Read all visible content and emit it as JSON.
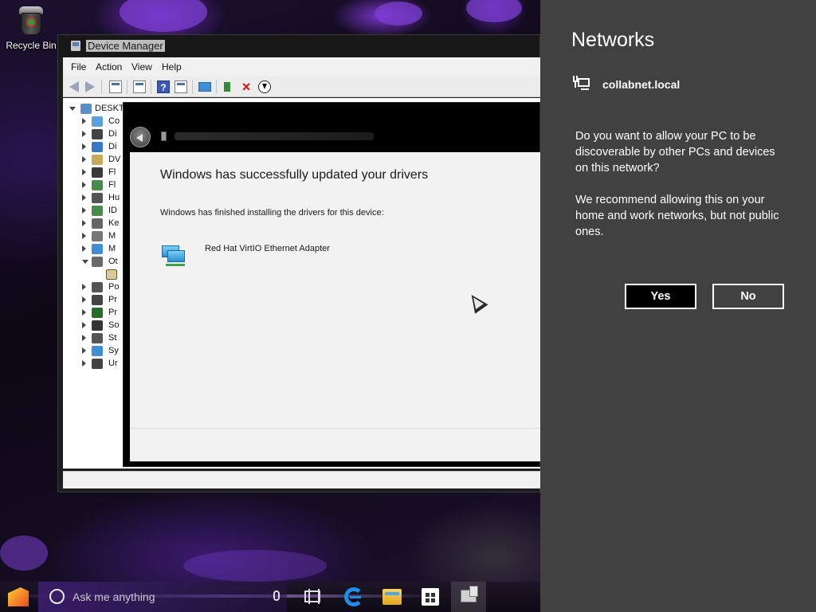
{
  "desktop": {
    "recycle_bin_label": "Recycle Bin"
  },
  "device_manager": {
    "title": "Device Manager",
    "menu": [
      "File",
      "Action",
      "View",
      "Help"
    ],
    "toolbar_icons": [
      "back-arrow-icon",
      "forward-arrow-icon",
      "properties-icon",
      "console-icon",
      "help-icon",
      "show-hidden-icon",
      "monitor-icon",
      "update-driver-icon",
      "uninstall-icon",
      "download-icon"
    ],
    "tree": {
      "root": "DESKT",
      "items": [
        {
          "label": "Co",
          "color": "#5aa0dc"
        },
        {
          "label": "Di",
          "color": "#444444"
        },
        {
          "label": "Di",
          "color": "#3a78c2"
        },
        {
          "label": "DV",
          "color": "#c9a85a"
        },
        {
          "label": "Fl",
          "color": "#3a3a3a"
        },
        {
          "label": "Fl",
          "color": "#4a8a4a"
        },
        {
          "label": "Hu",
          "color": "#555555"
        },
        {
          "label": "ID",
          "color": "#4a8a4a"
        },
        {
          "label": "Ke",
          "color": "#666666"
        },
        {
          "label": "M",
          "color": "#777777"
        },
        {
          "label": "M",
          "color": "#3e8fd4"
        },
        {
          "label": "Ot",
          "color": "#6a6a6a"
        },
        {
          "label": "Po",
          "color": "#555555"
        },
        {
          "label": "Pr",
          "color": "#444444"
        },
        {
          "label": "Pr",
          "color": "#2a6a2a"
        },
        {
          "label": "So",
          "color": "#333333"
        },
        {
          "label": "St",
          "color": "#555555"
        },
        {
          "label": "Sy",
          "color": "#3e8fd4"
        },
        {
          "label": "Ur",
          "color": "#444444"
        }
      ]
    }
  },
  "update_dialog": {
    "heading": "Windows has successfully updated your drivers",
    "subtext": "Windows has finished installing the drivers for this device:",
    "device_name": "Red Hat VirtIO Ethernet Adapter"
  },
  "taskbar": {
    "search_placeholder": "Ask me anything"
  },
  "networks": {
    "title": "Networks",
    "network_name": "collabnet.local",
    "question": "Do you want to allow your PC to be discoverable by other PCs and devices on this network?",
    "recommendation": "We recommend allowing this on your home and work networks, but not public ones.",
    "yes_label": "Yes",
    "no_label": "No"
  }
}
